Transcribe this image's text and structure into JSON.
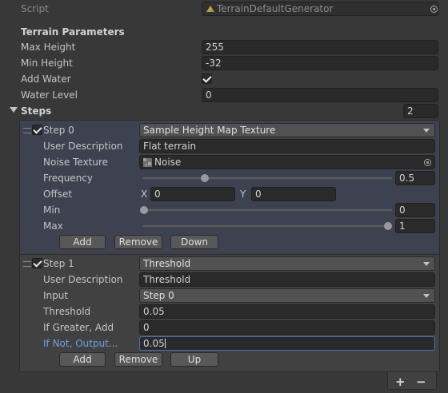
{
  "script_row": {
    "label": "Script",
    "value": "TerrainDefaultGenerator"
  },
  "terrain": {
    "header": "Terrain Parameters",
    "max_height": {
      "label": "Max Height",
      "value": "255"
    },
    "min_height": {
      "label": "Min Height",
      "value": "-32"
    },
    "add_water": {
      "label": "Add Water",
      "checked": true
    },
    "water_level": {
      "label": "Water Level",
      "value": "0"
    }
  },
  "steps": {
    "label": "Steps",
    "count": "2",
    "step0": {
      "title": "Step 0",
      "type": "Sample Height Map Texture",
      "user_description": {
        "label": "User Description",
        "value": "Flat terrain"
      },
      "noise_texture": {
        "label": "Noise Texture",
        "value": "Noise"
      },
      "frequency": {
        "label": "Frequency",
        "value": "0.5",
        "fraction": 0.5
      },
      "offset": {
        "label": "Offset",
        "x_label": "X",
        "x": "0",
        "y_label": "Y",
        "y": "0"
      },
      "min": {
        "label": "Min",
        "value": "0",
        "fraction": 0
      },
      "max": {
        "label": "Max",
        "value": "1",
        "fraction": 1
      },
      "buttons": {
        "add": "Add",
        "remove": "Remove",
        "down": "Down"
      }
    },
    "step1": {
      "title": "Step 1",
      "type": "Threshold",
      "user_description": {
        "label": "User Description",
        "value": "Threshold"
      },
      "input": {
        "label": "Input",
        "value": "Step 0"
      },
      "threshold": {
        "label": "Threshold",
        "value": "0.05"
      },
      "if_greater": {
        "label": "If Greater, Add",
        "value": "0"
      },
      "if_not": {
        "label": "If Not, Output...",
        "value": "0.05"
      },
      "buttons": {
        "add": "Add",
        "remove": "Remove",
        "up": "Up"
      }
    },
    "footer": {
      "add": "+",
      "remove": "−"
    }
  },
  "colors": {
    "background": "#383838",
    "field": "#2a2a2a",
    "focus": "#3a79bb",
    "label_focus": "#6f9fe0"
  },
  "icons": {
    "script": "script-asset-icon",
    "texture": "texture-thumb-icon",
    "picker": "object-picker-icon"
  }
}
